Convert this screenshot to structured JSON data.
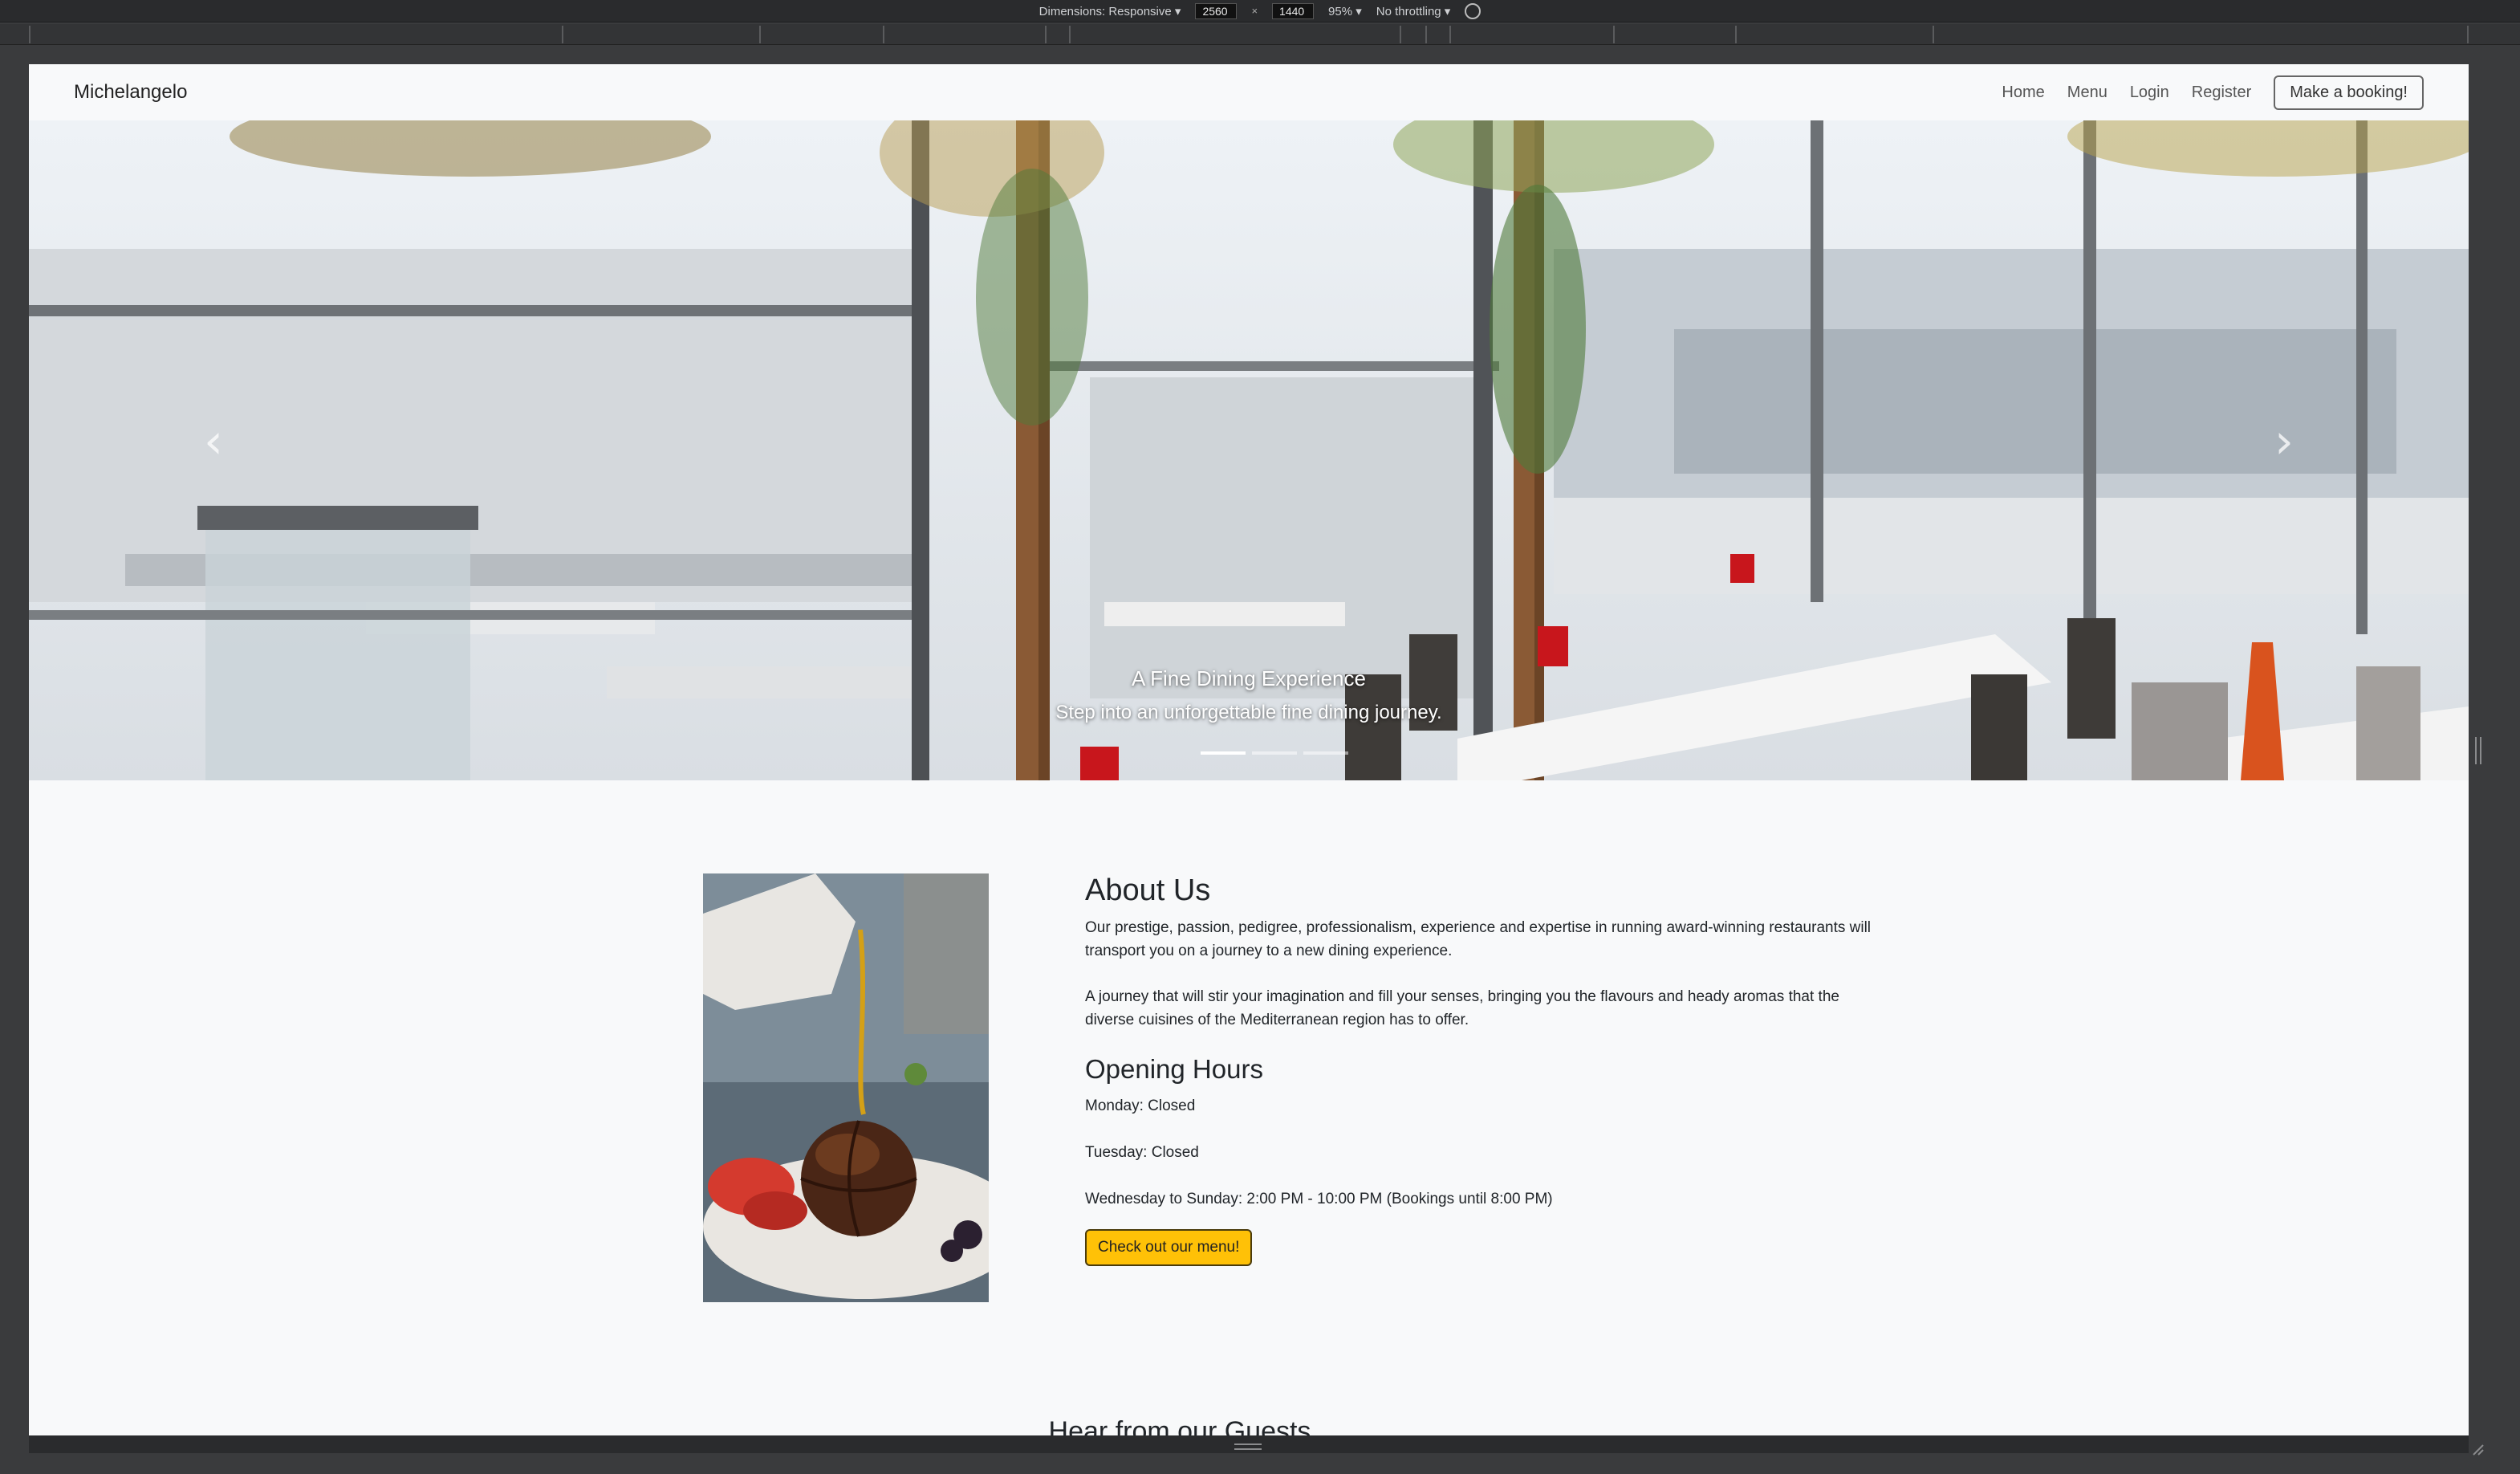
{
  "devtools": {
    "dimensions_label": "Dimensions: Responsive ▾",
    "width": "2560",
    "times": "×",
    "height": "1440",
    "zoom": "95% ▾",
    "throttling": "No throttling ▾"
  },
  "navbar": {
    "brand": "Michelangelo",
    "links": [
      "Home",
      "Menu",
      "Login",
      "Register"
    ],
    "booking_button": "Make a booking!"
  },
  "hero": {
    "caption_title": "A Fine Dining Experience",
    "caption_subtitle": "Step into an unforgettable fine dining journey.",
    "prev_icon": "‹",
    "next_icon": "›",
    "slides": 3,
    "active_slide": 1
  },
  "about": {
    "title": "About Us",
    "paragraphs": [
      "Our prestige, passion, pedigree, professionalism, experience and expertise in running award-winning restaurants will transport you on a journey to a new dining experience.",
      "A journey that will stir your imagination and fill your senses, bringing you the flavours and heady aromas that the diverse cuisines of the Mediterranean region has to offer."
    ]
  },
  "hours": {
    "title": "Opening Hours",
    "lines": [
      "Monday: Closed",
      "Tuesday: Closed",
      "Wednesday to Sunday: 2:00 PM - 10:00 PM (Bookings until 8:00 PM)"
    ],
    "menu_button": "Check out our menu!"
  },
  "guests": {
    "title": "Hear from our Guests"
  },
  "colors": {
    "accent": "#ffc107",
    "page_bg": "#f8f9fa",
    "devtools_bg": "#2a2b2d"
  }
}
